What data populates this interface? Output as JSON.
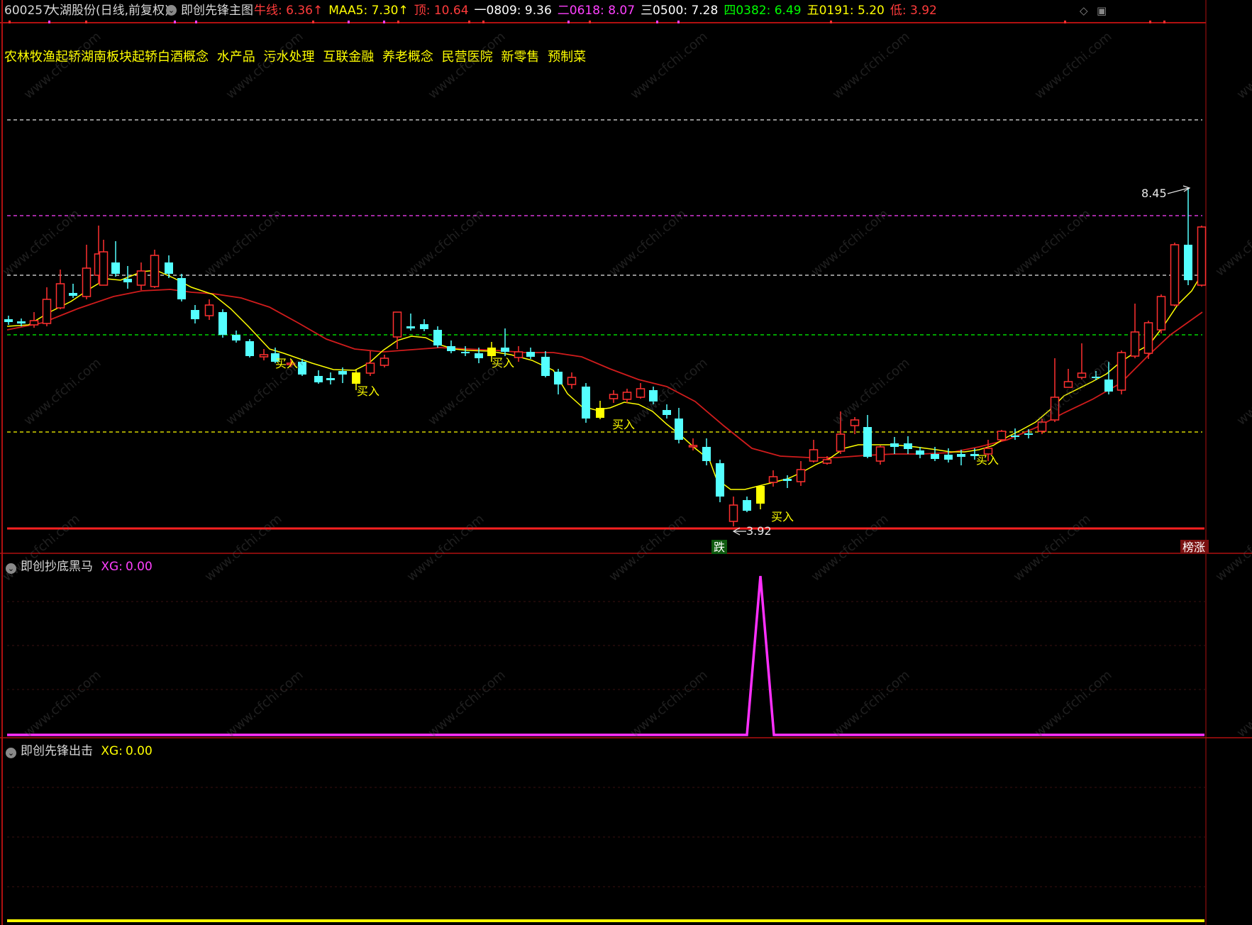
{
  "header": {
    "code": "600257",
    "name": "大湖股份(日线,前复权)",
    "indicator": "即创先锋主图",
    "items": [
      {
        "label": "牛线:",
        "value": "6.36",
        "arrow": "↑",
        "color": "#ff3b3b"
      },
      {
        "label": "MAA5:",
        "value": "7.30",
        "arrow": "↑",
        "color": "#ffff00"
      },
      {
        "label": "顶:",
        "value": "10.64",
        "arrow": "",
        "color": "#ff3b3b"
      },
      {
        "label": "一0809:",
        "value": "9.36",
        "arrow": "",
        "color": "#ffffff"
      },
      {
        "label": "二0618:",
        "value": "8.07",
        "arrow": "",
        "color": "#ff40ff"
      },
      {
        "label": "三0500:",
        "value": "7.28",
        "arrow": "",
        "color": "#ffffff"
      },
      {
        "label": "四0382:",
        "value": "6.49",
        "arrow": "",
        "color": "#00ff00"
      },
      {
        "label": "五0191:",
        "value": "5.20",
        "arrow": "",
        "color": "#ffff00"
      },
      {
        "label": "低:",
        "value": "3.92",
        "arrow": "",
        "color": "#ff3b3b"
      }
    ]
  },
  "concepts": [
    "农林牧渔",
    "起轿湖南",
    "板块起轿",
    "白酒概念",
    "水产品",
    "污水处理",
    "互联金融",
    "养老概念",
    "民营医院",
    "新零售",
    "预制菜"
  ],
  "main_chart": {
    "high_label": "8.45",
    "low_label": "3.92",
    "buy_label": "买入",
    "buy_signal_count": 8,
    "badge_left": "跌",
    "badge_right": "榜涨",
    "colors": {
      "up": "#ff3030",
      "down": "#54ffff",
      "signal": "#ffff00",
      "ma_short": "#ffff00",
      "ma_long": "#e02020"
    }
  },
  "panel2": {
    "title": "即创抄底黑马",
    "label": "XG:",
    "value": "0.00",
    "color": "#ff40ff"
  },
  "panel3": {
    "title": "即创先锋出击",
    "label": "XG:",
    "value": "0.00",
    "color": "#ffff00"
  },
  "watermark": "www.cfchi.com"
}
